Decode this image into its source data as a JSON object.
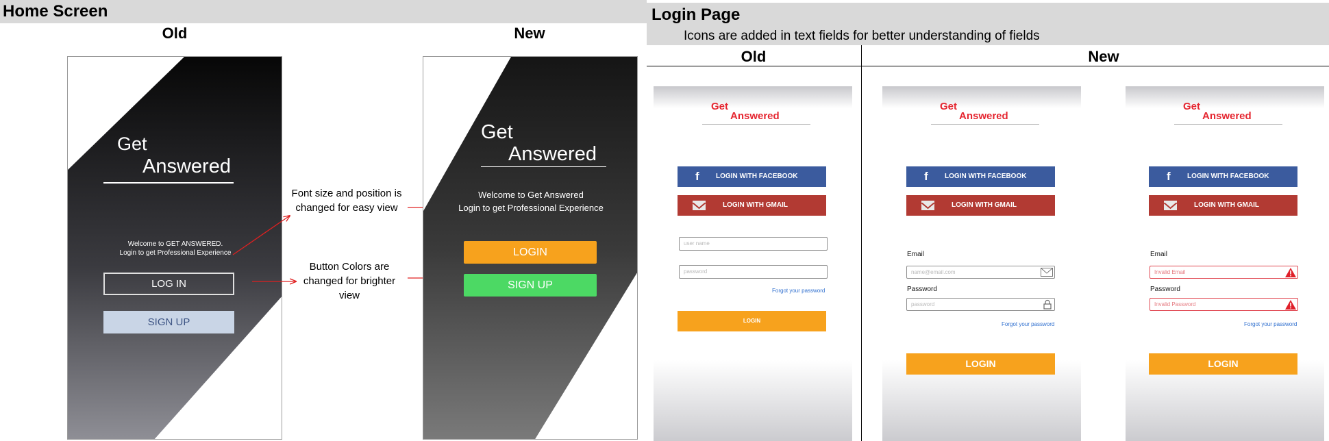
{
  "home": {
    "section_title": "Home Screen",
    "old_heading": "Old",
    "new_heading": "New",
    "old_phone": {
      "logo_get": "Get",
      "logo_answered": "Answered",
      "welcome_line1": "Welcome to GET ANSWERED.",
      "welcome_line2": "Login to get Professional Experience",
      "login_label": "LOG IN",
      "signup_label": "SIGN UP"
    },
    "new_phone": {
      "logo_get": "Get",
      "logo_answered": "Answered",
      "welcome_line1": "Welcome to Get Answered",
      "welcome_line2": "Login to get Professional Experience",
      "login_label": "LOGIN",
      "signup_label": "SIGN UP"
    },
    "notes": {
      "font_line1": "Font size and position is",
      "font_line2": "changed for easy view",
      "button_line1": "Button Colors are",
      "button_line2": "changed for brighter",
      "button_line3": "view"
    }
  },
  "login": {
    "section_title": "Login Page",
    "subtitle": "Icons are added in text fields for better understanding  of fields",
    "old_heading": "Old",
    "new_heading": "New",
    "logo_get": "Get",
    "logo_answered": "Answered",
    "facebook_label": "LOGIN WITH FACEBOOK",
    "gmail_label": "LOGIN WITH GMAIL",
    "old_phone": {
      "username_placeholder": "user name",
      "password_placeholder": "password",
      "forgot_label": "Forgot your password",
      "login_label": "LOGIN"
    },
    "new_phone": {
      "email_label": "Email",
      "email_placeholder": "name@email.com",
      "password_label": "Password",
      "password_placeholder": "password",
      "forgot_label": "Forgot your password",
      "login_label": "LOGIN"
    },
    "error_phone": {
      "email_label": "Email",
      "email_placeholder": "Invalid Email",
      "password_label": "Password",
      "password_placeholder": "Invalid Password",
      "forgot_label": "Forgot your password",
      "login_label": "LOGIN"
    }
  },
  "colors": {
    "orange": "#f7a21d",
    "green": "#4cd964",
    "facebook": "#3b5b9e",
    "gmail": "#b23a33",
    "logo_red": "#e52630",
    "arrow_red": "#e02020"
  }
}
